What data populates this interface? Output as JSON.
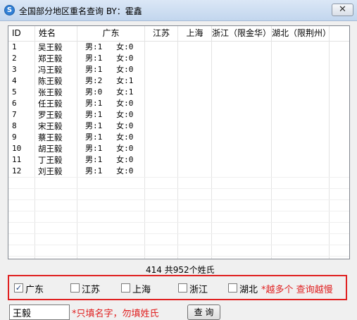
{
  "window": {
    "icon_glyph": "S",
    "icon_name": "app-icon",
    "title": "全国部分地区重名查询   BY：霍鑫",
    "close_label": "✕"
  },
  "table": {
    "columns": [
      "ID",
      "姓名",
      "广东",
      "江苏",
      "上海",
      "浙江（限金华）",
      "湖北（限荆州）"
    ],
    "rows": [
      {
        "id": "1",
        "name": "吴王毅",
        "guangdong": "男:1   女:0"
      },
      {
        "id": "2",
        "name": "郑王毅",
        "guangdong": "男:1   女:0"
      },
      {
        "id": "3",
        "name": "冯王毅",
        "guangdong": "男:1   女:0"
      },
      {
        "id": "4",
        "name": "陈王毅",
        "guangdong": "男:2   女:1"
      },
      {
        "id": "5",
        "name": "张王毅",
        "guangdong": "男:0   女:1"
      },
      {
        "id": "6",
        "name": "任王毅",
        "guangdong": "男:1   女:0"
      },
      {
        "id": "7",
        "name": "罗王毅",
        "guangdong": "男:1   女:0"
      },
      {
        "id": "8",
        "name": "宋王毅",
        "guangdong": "男:1   女:0"
      },
      {
        "id": "9",
        "name": "蔡王毅",
        "guangdong": "男:1   女:0"
      },
      {
        "id": "10",
        "name": "胡王毅",
        "guangdong": "男:1   女:0"
      },
      {
        "id": "11",
        "name": "丁王毅",
        "guangdong": "男:1   女:0"
      },
      {
        "id": "12",
        "name": "刘王毅",
        "guangdong": "男:1   女:0"
      }
    ]
  },
  "summary": "414   共952个姓氏",
  "filters": {
    "options": [
      {
        "label": "广东",
        "checked": true
      },
      {
        "label": "江苏",
        "checked": false
      },
      {
        "label": "上海",
        "checked": false
      },
      {
        "label": "浙江",
        "checked": false
      },
      {
        "label": "湖北",
        "checked": false
      }
    ],
    "warning": "*越多个 查询越慢",
    "highlight_color": "#e02020"
  },
  "search": {
    "value": "王毅",
    "hint": "*只填名字，勿填姓氏",
    "button_label": "查 询"
  }
}
